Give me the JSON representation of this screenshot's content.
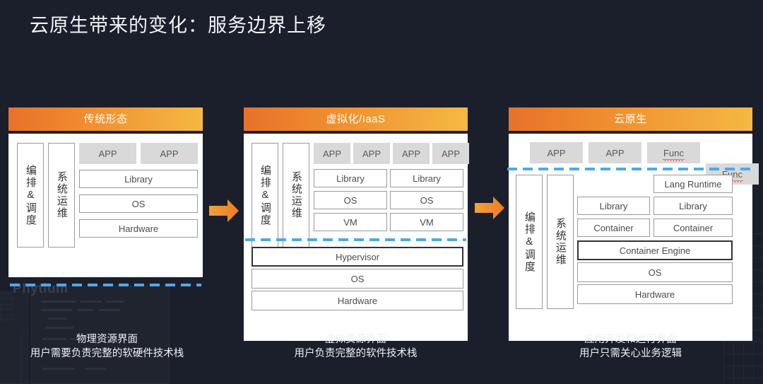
{
  "page": {
    "title": "云原生带来的变化：服务边界上移",
    "background_color": "#1b1f2b",
    "watermark": "Phytium",
    "accent_orange_start": "#e8712a",
    "accent_orange_end": "#f5b942",
    "dashed_line_color": "#4fa8e8",
    "app_box_color": "#d9d9d9"
  },
  "columns": [
    {
      "header": "传统形态",
      "orchestration_label": "编排&调度",
      "ops_label": "系统运维",
      "apps": [
        "APP",
        "APP"
      ],
      "stack": [
        "Library",
        "OS",
        "Hardware"
      ],
      "caption_line1": "物理资源界面",
      "caption_line2": "用户需要负责完整的软硬件技术栈"
    },
    {
      "header_main": "虚拟化/",
      "header_sub": "IaaS",
      "header": "虚拟化/IaaS",
      "orchestration_label": "编排&调度",
      "ops_label": "系统运维",
      "apps": [
        "APP",
        "APP",
        "APP",
        "APP"
      ],
      "guest_left": [
        "Library",
        "OS",
        "VM"
      ],
      "guest_right": [
        "Library",
        "OS",
        "VM"
      ],
      "host_stack": [
        "Hypervisor",
        "OS",
        "Hardware"
      ],
      "caption_line1": "虚拟资源界面",
      "caption_line2": "用户负责完整的软件技术栈"
    },
    {
      "header": "云原生",
      "orchestration_label": "编排&调度",
      "ops_label": "系统运维",
      "apps": [
        "APP",
        "APP",
        "Func",
        "Func"
      ],
      "left_stack": [
        "Library",
        "Container"
      ],
      "right_stack": [
        "Lang Runtime",
        "Library",
        "Container"
      ],
      "base_stack": [
        "Container Engine",
        "OS",
        "Hardware"
      ],
      "caption_line1": "应用开发和运行界面",
      "caption_line2": "用户只需关心业务逻辑"
    }
  ],
  "arrows": [
    {
      "name": "arrow-traditional-to-virtualization"
    },
    {
      "name": "arrow-virtualization-to-cloudnative"
    }
  ]
}
